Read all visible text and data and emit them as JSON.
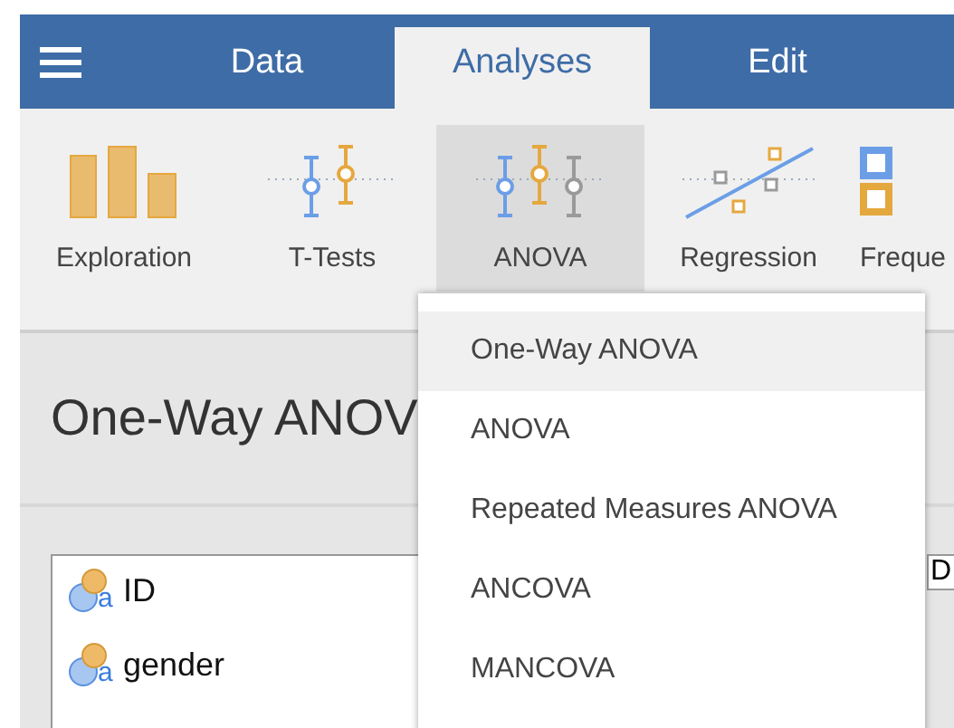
{
  "tabs": [
    {
      "label": "Data",
      "selected": false
    },
    {
      "label": "Analyses",
      "selected": true
    },
    {
      "label": "Edit",
      "selected": false
    }
  ],
  "ribbon": [
    {
      "label": "Exploration",
      "kind": "bars",
      "selected": false
    },
    {
      "label": "T-Tests",
      "kind": "ttest",
      "selected": false
    },
    {
      "label": "ANOVA",
      "kind": "anova",
      "selected": true
    },
    {
      "label": "Regression",
      "kind": "regression",
      "selected": false
    },
    {
      "label": "Freque",
      "kind": "frequencies",
      "selected": false
    }
  ],
  "analysis": {
    "title": "One-Way ANOV"
  },
  "variables": [
    {
      "name": "ID",
      "type_mark": "a"
    },
    {
      "name": "gender",
      "type_mark": "a"
    }
  ],
  "side_box": {
    "label": "D"
  },
  "menu": [
    {
      "label": "One-Way ANOVA",
      "selected": true
    },
    {
      "label": "ANOVA",
      "selected": false
    },
    {
      "label": "Repeated Measures ANOVA",
      "selected": false
    },
    {
      "label": "ANCOVA",
      "selected": false
    },
    {
      "label": "MANCOVA",
      "selected": false
    }
  ]
}
